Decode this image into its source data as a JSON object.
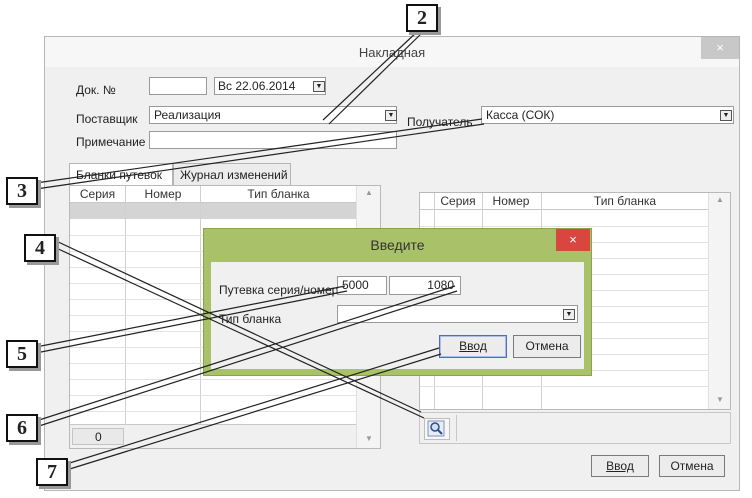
{
  "window": {
    "title": "Накладная",
    "close_glyph": "×"
  },
  "form": {
    "doc_label": "Док. №",
    "doc_value": "",
    "date_value": "Вс  22.06.2014",
    "supplier_label": "Поставщик",
    "supplier_value": "Реализация",
    "recipient_label": "Получатель",
    "recipient_value": "Касса (СОК)",
    "note_label": "Примечание",
    "note_value": ""
  },
  "tabs": [
    {
      "label": "Бланки путевок"
    },
    {
      "label": "Журнал изменений"
    }
  ],
  "grid_left": {
    "columns": [
      "Серия",
      "Номер",
      "Тип бланка"
    ],
    "footer_count": "0"
  },
  "grid_right": {
    "columns": [
      "Серия",
      "Номер",
      "Тип бланка"
    ]
  },
  "icons": {
    "dropdown": "dropdown-arrow-icon",
    "search": "magnifier-icon"
  },
  "modal": {
    "title": "Введите",
    "close_glyph": "×",
    "series_label": "Путевка серия/номер",
    "series_value": "5000",
    "number_value": "1080",
    "type_label": "Тип бланка",
    "type_value": "",
    "ok_label": "Ввод",
    "cancel_label": "Отмена"
  },
  "buttons": {
    "ok_label": "Ввод",
    "cancel_label": "Отмена"
  },
  "callouts": [
    "2",
    "3",
    "4",
    "5",
    "6",
    "7"
  ],
  "colors": {
    "modal_frame": "#a9c26a",
    "modal_close": "#d9463f",
    "selection_row": "#d4d4d4"
  }
}
